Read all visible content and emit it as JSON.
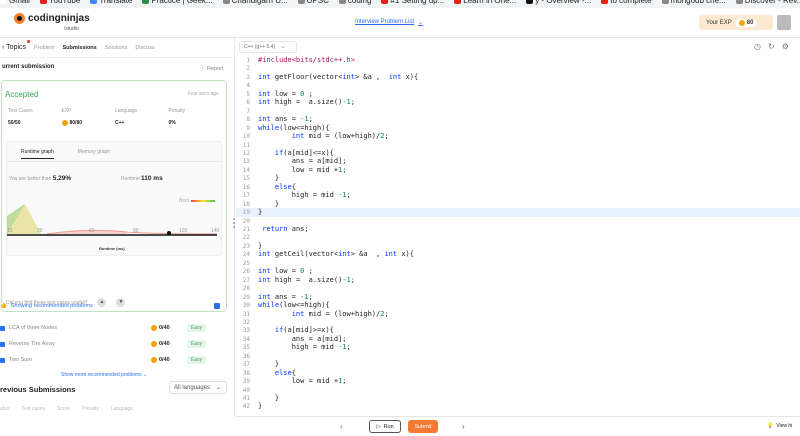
{
  "bookmarks": [
    {
      "label": "Gmail",
      "color": "#ffffff"
    },
    {
      "label": "YouTube",
      "color": "#e62117"
    },
    {
      "label": "Translate",
      "color": "#4285f4"
    },
    {
      "label": "Practice | Geek...",
      "color": "#2f8d46"
    },
    {
      "label": "Chandigarh U...",
      "color": "#888888"
    },
    {
      "label": "UPSC",
      "color": "#888888"
    },
    {
      "label": "coding",
      "color": "#888888"
    },
    {
      "label": "#1 Setting up...",
      "color": "#e62117"
    },
    {
      "label": "Learn in One...",
      "color": "#e62117"
    },
    {
      "label": "y - Overview -...",
      "color": "#111111"
    },
    {
      "label": "to complete",
      "color": "#e62117"
    },
    {
      "label": "mongodb che...",
      "color": "#888888"
    },
    {
      "label": "Discover - Rev...",
      "color": "#888888"
    },
    {
      "label": "»",
      "color": ""
    },
    {
      "label": "All Bookm",
      "color": "#888888"
    }
  ],
  "header": {
    "logo_text": "codingninjas",
    "logo_sub": "/studio",
    "problem_list": "Interview Problem List",
    "exp_label": "Your EXP",
    "exp_value": "80"
  },
  "left": {
    "tabs": [
      "Topics",
      "Problem",
      "Submissions",
      "Solutions",
      "Discuss"
    ],
    "current_submission": "urrent submission",
    "report": "Report",
    "status": "Accepted",
    "time_ago": "Few secs ago",
    "stats": [
      {
        "label": "Test Cases",
        "value": "50/50"
      },
      {
        "label": "EXP",
        "value": "80/80"
      },
      {
        "label": "Language",
        "value": "C++"
      },
      {
        "label": "Penalty",
        "value": "0%"
      }
    ],
    "graph_tabs": [
      "Runtime graph",
      "Memory graph"
    ],
    "better_label": "You are better than",
    "better_value": "5.29%",
    "runtime_label": "Runtime",
    "runtime_value": "110 ms",
    "best_label": "Best",
    "x_ticks": [
      "10",
      "30",
      "60",
      "90",
      "120",
      "140"
    ],
    "x_title": "Runtime (ms)",
    "useful": "Did you find these test cases useful?",
    "recommended": "Showing recommended problems",
    "problems": [
      {
        "name": "LCA of three Nodes",
        "points": "0/40",
        "difficulty": "Easy"
      },
      {
        "name": "Reverse The Array",
        "points": "0/40",
        "difficulty": "Easy"
      },
      {
        "name": "Two Sum",
        "points": "0/40",
        "difficulty": "Easy"
      }
    ],
    "show_more": "Show more recommended problems",
    "prev_title": "revious Submissions",
    "all_languages": "All languages",
    "prev_cols": [
      "atus",
      "Test cases",
      "Score",
      "Penalty",
      "Language"
    ]
  },
  "editor": {
    "language": "C++ (g++ 5.4)",
    "lines": [
      {
        "n": "1",
        "t": "#include<bits/stdc++.h>"
      },
      {
        "n": "2",
        "t": ""
      },
      {
        "n": "3",
        "t": "int getFloor(vector<int> &a ,  int x){"
      },
      {
        "n": "4",
        "t": ""
      },
      {
        "n": "5",
        "t": "int low = 0 ;"
      },
      {
        "n": "6",
        "t": "int high =  a.size()-1;"
      },
      {
        "n": "7",
        "t": ""
      },
      {
        "n": "8",
        "t": "int ans = -1;"
      },
      {
        "n": "9",
        "t": "while(low<=high){"
      },
      {
        "n": "10",
        "t": "        int mid = (low+high)/2;"
      },
      {
        "n": "11",
        "t": ""
      },
      {
        "n": "12",
        "t": "    if(a[mid]<=x){"
      },
      {
        "n": "13",
        "t": "        ans = a[mid];"
      },
      {
        "n": "14",
        "t": "        low = mid +1;"
      },
      {
        "n": "15",
        "t": "    }"
      },
      {
        "n": "16",
        "t": "    else{"
      },
      {
        "n": "17",
        "t": "        high = mid -1;"
      },
      {
        "n": "18",
        "t": "    }"
      },
      {
        "n": "19",
        "t": "}"
      },
      {
        "n": "20",
        "t": ""
      },
      {
        "n": "21",
        "t": " return ans;"
      },
      {
        "n": "22",
        "t": ""
      },
      {
        "n": "23",
        "t": "}"
      },
      {
        "n": "24",
        "t": "int getCeil(vector<int> &a  , int x){"
      },
      {
        "n": "25",
        "t": ""
      },
      {
        "n": "26",
        "t": "int low = 0 ;"
      },
      {
        "n": "27",
        "t": "int high =  a.size()-1;"
      },
      {
        "n": "28",
        "t": ""
      },
      {
        "n": "29",
        "t": "int ans = -1;"
      },
      {
        "n": "30",
        "t": "while(low<=high){"
      },
      {
        "n": "31",
        "t": "        int mid = (low+high)/2;"
      },
      {
        "n": "32",
        "t": ""
      },
      {
        "n": "33",
        "t": "    if(a[mid]>=x){"
      },
      {
        "n": "34",
        "t": "        ans = a[mid];"
      },
      {
        "n": "35",
        "t": "        high = mid -1;"
      },
      {
        "n": "36",
        "t": ""
      },
      {
        "n": "37",
        "t": "    }"
      },
      {
        "n": "38",
        "t": "    else{"
      },
      {
        "n": "39",
        "t": "        low = mid +1;"
      },
      {
        "n": "40",
        "t": ""
      },
      {
        "n": "41",
        "t": "    }"
      },
      {
        "n": "42",
        "t": "}"
      }
    ],
    "highlight_line": "19"
  },
  "bottom": {
    "run": "Run",
    "submit": "Submit",
    "view_hint": "View hi"
  },
  "colors": {
    "accent": "#f37a35",
    "link": "#2b6ff0",
    "success": "#3ea35a"
  }
}
